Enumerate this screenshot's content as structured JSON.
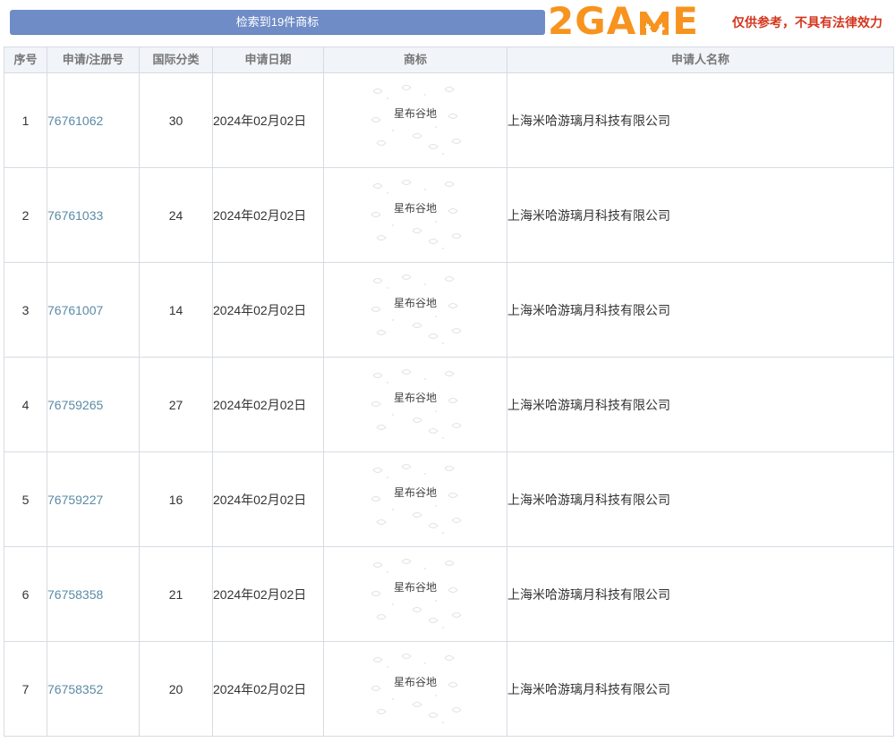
{
  "header": {
    "result_banner": "检索到19件商标",
    "logo_digit": "2",
    "logo_letters_pre": "GA",
    "logo_letters_post": "E",
    "disclaimer": "仅供参考，不具有法律效力",
    "colors": {
      "banner": "#6f8cc7",
      "logo": "#f7931e",
      "disclaimer": "#d4361e",
      "link": "#5b8aa6"
    }
  },
  "table": {
    "columns": [
      "序号",
      "申请/注册号",
      "国际分类",
      "申请日期",
      "商标",
      "申请人名称"
    ],
    "rows": [
      {
        "index": "1",
        "reg_no": "76761062",
        "class": "30",
        "date": "2024年02月02日",
        "mark": "星布谷地",
        "applicant": "上海米哈游璃月科技有限公司"
      },
      {
        "index": "2",
        "reg_no": "76761033",
        "class": "24",
        "date": "2024年02月02日",
        "mark": "星布谷地",
        "applicant": "上海米哈游璃月科技有限公司"
      },
      {
        "index": "3",
        "reg_no": "76761007",
        "class": "14",
        "date": "2024年02月02日",
        "mark": "星布谷地",
        "applicant": "上海米哈游璃月科技有限公司"
      },
      {
        "index": "4",
        "reg_no": "76759265",
        "class": "27",
        "date": "2024年02月02日",
        "mark": "星布谷地",
        "applicant": "上海米哈游璃月科技有限公司"
      },
      {
        "index": "5",
        "reg_no": "76759227",
        "class": "16",
        "date": "2024年02月02日",
        "mark": "星布谷地",
        "applicant": "上海米哈游璃月科技有限公司"
      },
      {
        "index": "6",
        "reg_no": "76758358",
        "class": "21",
        "date": "2024年02月02日",
        "mark": "星布谷地",
        "applicant": "上海米哈游璃月科技有限公司"
      },
      {
        "index": "7",
        "reg_no": "76758352",
        "class": "20",
        "date": "2024年02月02日",
        "mark": "星布谷地",
        "applicant": "上海米哈游璃月科技有限公司"
      }
    ]
  }
}
